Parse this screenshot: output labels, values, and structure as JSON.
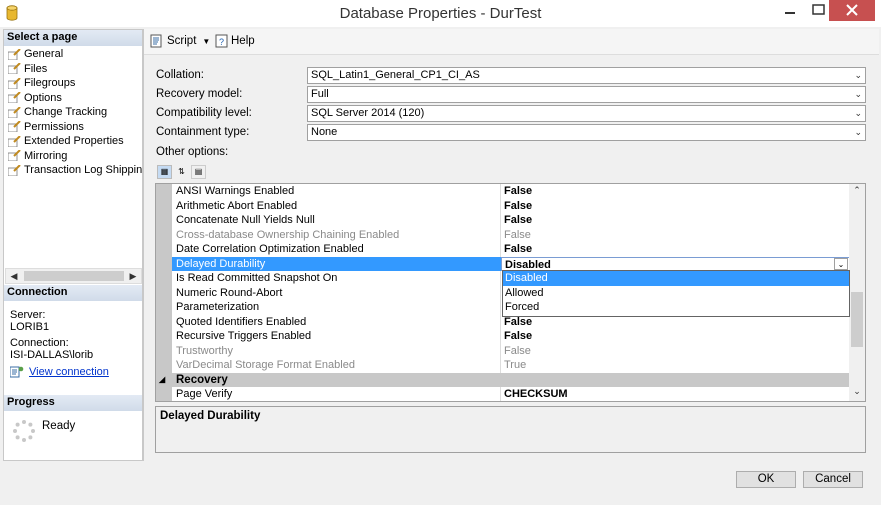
{
  "window": {
    "title": "Database Properties - DurTest"
  },
  "select_page": {
    "header": "Select a page",
    "items": [
      {
        "label": "General"
      },
      {
        "label": "Files"
      },
      {
        "label": "Filegroups"
      },
      {
        "label": "Options"
      },
      {
        "label": "Change Tracking"
      },
      {
        "label": "Permissions"
      },
      {
        "label": "Extended Properties"
      },
      {
        "label": "Mirroring"
      },
      {
        "label": "Transaction Log Shipping"
      }
    ]
  },
  "connection": {
    "header": "Connection",
    "server_label": "Server:",
    "server_value": "LORIB1",
    "connection_label": "Connection:",
    "connection_value": "ISI-DALLAS\\lorib",
    "view_link": "View connection"
  },
  "progress": {
    "header": "Progress",
    "status": "Ready"
  },
  "toolbar": {
    "script_label": "Script",
    "help_label": "Help"
  },
  "form": {
    "collation": {
      "label": "Collation:",
      "value": "SQL_Latin1_General_CP1_CI_AS"
    },
    "recovery": {
      "label": "Recovery model:",
      "value": "Full"
    },
    "compat": {
      "label": "Compatibility level:",
      "value": "SQL Server 2014 (120)"
    },
    "containment": {
      "label": "Containment type:",
      "value": "None"
    },
    "other_label": "Other options:"
  },
  "grid": {
    "rows": [
      {
        "name": "ANSI Warnings Enabled",
        "value": "False",
        "dim": false
      },
      {
        "name": "Arithmetic Abort Enabled",
        "value": "False",
        "dim": false
      },
      {
        "name": "Concatenate Null Yields Null",
        "value": "False",
        "dim": false
      },
      {
        "name": "Cross-database Ownership Chaining Enabled",
        "value": "False",
        "dim": true
      },
      {
        "name": "Date Correlation Optimization Enabled",
        "value": "False",
        "dim": false
      },
      {
        "name": "Delayed Durability",
        "value": "Disabled",
        "dim": false,
        "selected": true
      },
      {
        "name": "Is Read Committed Snapshot On",
        "value": "",
        "dim": false
      },
      {
        "name": "Numeric Round-Abort",
        "value": "",
        "dim": false
      },
      {
        "name": "Parameterization",
        "value": "",
        "dim": false
      },
      {
        "name": "Quoted Identifiers Enabled",
        "value": "False",
        "dim": false
      },
      {
        "name": "Recursive Triggers Enabled",
        "value": "False",
        "dim": false
      },
      {
        "name": "Trustworthy",
        "value": "False",
        "dim": true
      },
      {
        "name": "VarDecimal Storage Format Enabled",
        "value": "True",
        "dim": true
      }
    ],
    "category": "Recovery",
    "page_verify": {
      "name": "Page Verify",
      "value": "CHECKSUM"
    }
  },
  "dropdown": {
    "options": [
      "Disabled",
      "Allowed",
      "Forced"
    ],
    "active": "Disabled"
  },
  "description": {
    "title": "Delayed Durability"
  },
  "buttons": {
    "ok": "OK",
    "cancel": "Cancel"
  }
}
